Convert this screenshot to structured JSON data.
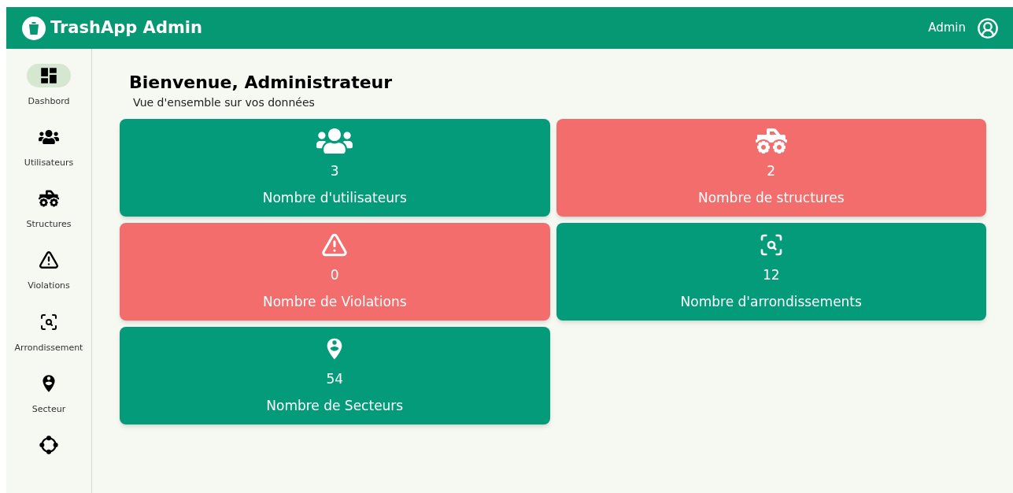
{
  "header": {
    "title": "TrashApp Admin",
    "user": "Admin"
  },
  "sidebar": {
    "items": [
      {
        "label": "Dashbord",
        "selected": true
      },
      {
        "label": "Utilisateurs",
        "selected": false
      },
      {
        "label": "Structures",
        "selected": false
      },
      {
        "label": "Violations",
        "selected": false
      },
      {
        "label": "Arrondissement",
        "selected": false
      },
      {
        "label": "Secteur",
        "selected": false
      },
      {
        "selected": false
      }
    ]
  },
  "welcome": {
    "title": "Bienvenue, Administrateur",
    "subtitle": "Vue d'ensemble sur vos données"
  },
  "cards": [
    {
      "value": "3",
      "label": "Nombre d'utilisateurs",
      "color": "#039b7a"
    },
    {
      "value": "2",
      "label": "Nombre de structures",
      "color": "#f36d6d"
    },
    {
      "value": "0",
      "label": "Nombre de Violations",
      "color": "#f36d6d"
    },
    {
      "value": "12",
      "label": "Nombre d'arrondissements",
      "color": "#039b7a"
    },
    {
      "value": "54",
      "label": "Nombre de Secteurs",
      "color": "#039b7a"
    }
  ]
}
